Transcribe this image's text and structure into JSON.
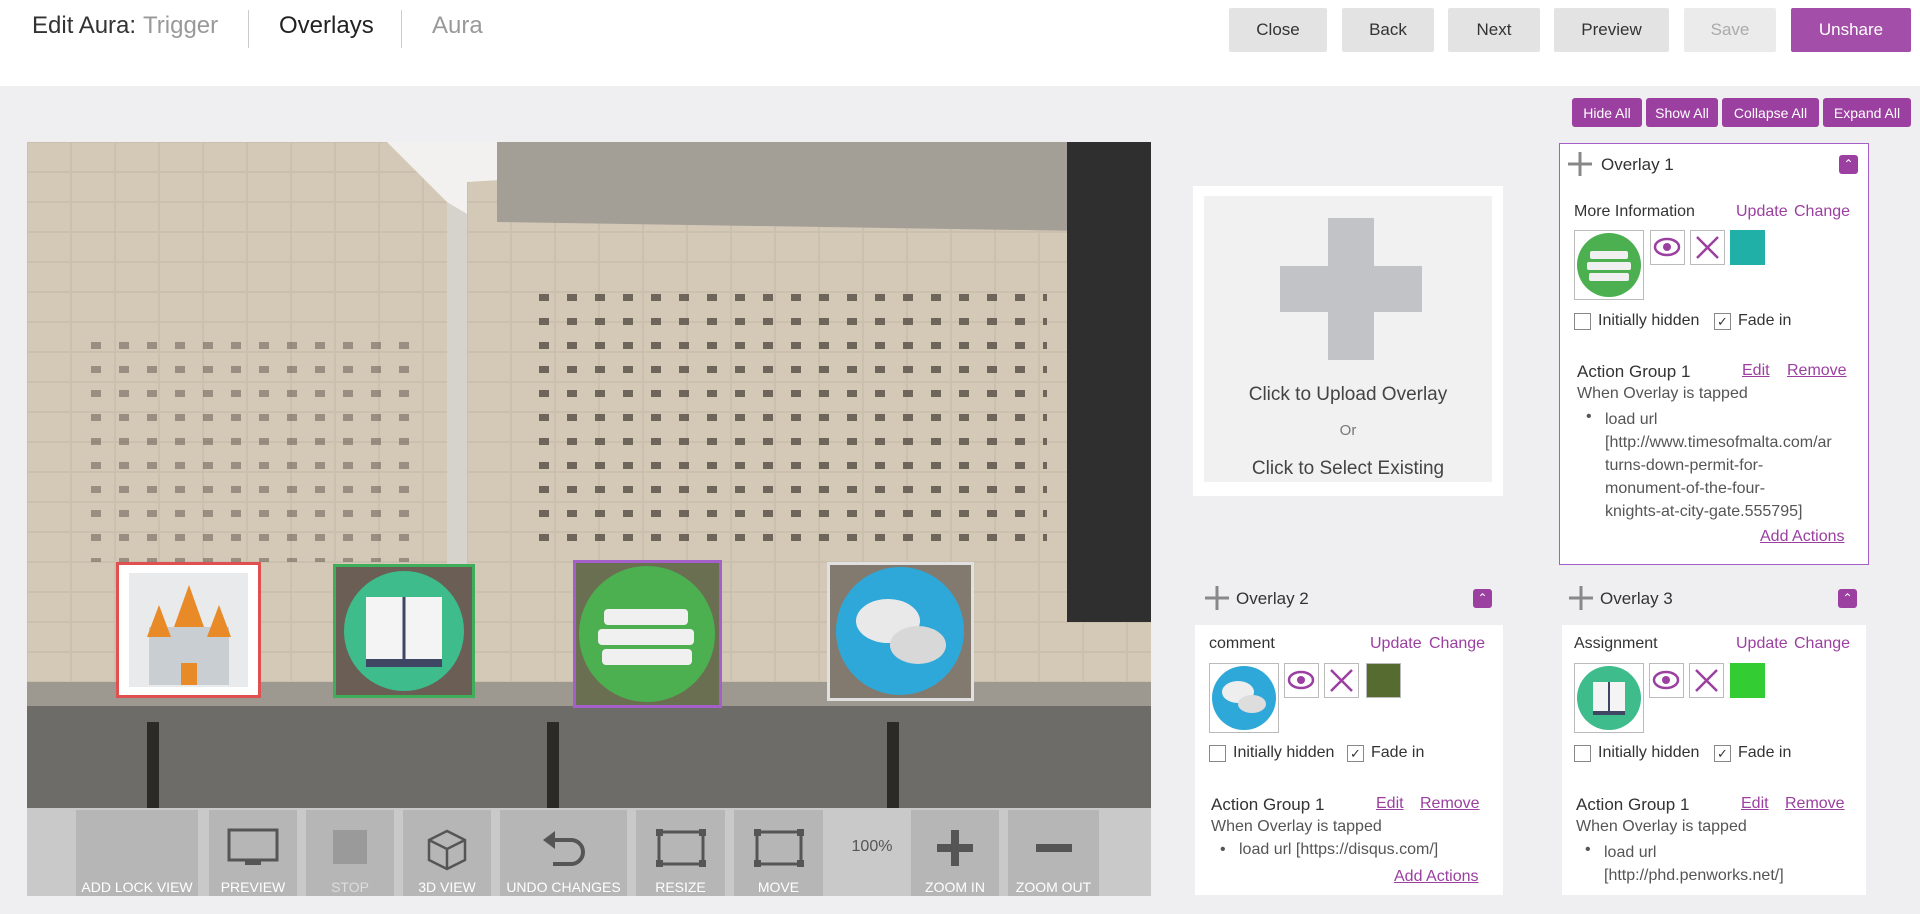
{
  "header": {
    "title": "Edit Aura:",
    "crumbs": [
      "Trigger",
      "Overlays",
      "Aura"
    ],
    "buttons": {
      "close": "Close",
      "back": "Back",
      "next": "Next",
      "preview": "Preview",
      "save": "Save",
      "unshare": "Unshare"
    }
  },
  "panel_controls": {
    "hide_all": "Hide All",
    "show_all": "Show All",
    "collapse_all": "Collapse All",
    "expand_all": "Expand All"
  },
  "toolbar": {
    "add_lock_view": "ADD LOCK VIEW",
    "preview": "PREVIEW",
    "stop": "STOP",
    "view_3d": "3D VIEW",
    "undo": "UNDO CHANGES",
    "resize": "RESIZE",
    "move": "MOVE",
    "zoom_level": "100%",
    "zoom_in": "ZOOM IN",
    "zoom_out": "ZOOM OUT"
  },
  "upload": {
    "upload_label": "Click to Upload Overlay",
    "or": "Or",
    "select_label": "Click to Select Existing"
  },
  "overlays": [
    {
      "title": "Overlay 1",
      "name": "More Information",
      "update": "Update",
      "change": "Change",
      "color": "#20b0a8",
      "icon": "books-icon",
      "initially_hidden_label": "Initially hidden",
      "initially_hidden": false,
      "fade_in_label": "Fade in",
      "fade_in": true,
      "action_group": "Action Group 1",
      "edit": "Edit",
      "remove": "Remove",
      "trigger": "When Overlay is tapped",
      "action": "load url [http://www.timesofmalta.com/ar turns-down-permit-for-monument-of-the-four-knights-at-city-gate.555795]",
      "action_lines": [
        "load url",
        "[http://www.timesofmalta.com/ar",
        "turns-down-permit-for-",
        "monument-of-the-four-",
        "knights-at-city-gate.555795]"
      ],
      "add_actions": "Add Actions"
    },
    {
      "title": "Overlay 2",
      "name": "comment",
      "update": "Update",
      "change": "Change",
      "color": "#556b2f",
      "icon": "chat-bubbles-icon",
      "initially_hidden_label": "Initially hidden",
      "initially_hidden": false,
      "fade_in_label": "Fade in",
      "fade_in": true,
      "action_group": "Action Group 1",
      "edit": "Edit",
      "remove": "Remove",
      "trigger": "When Overlay is tapped",
      "action": "load url [https://disqus.com/]",
      "add_actions": "Add Actions"
    },
    {
      "title": "Overlay 3",
      "name": "Assignment",
      "update": "Update",
      "change": "Change",
      "color": "#33cc33",
      "icon": "open-book-icon",
      "initially_hidden_label": "Initially hidden",
      "initially_hidden": false,
      "fade_in_label": "Fade in",
      "fade_in": true,
      "action_group": "Action Group 1",
      "edit": "Edit",
      "remove": "Remove",
      "trigger": "When Overlay is tapped",
      "action_lines": [
        "load url",
        "[http://phd.penworks.net/]"
      ]
    }
  ],
  "colors": {
    "accent": "#9b3fa0"
  }
}
